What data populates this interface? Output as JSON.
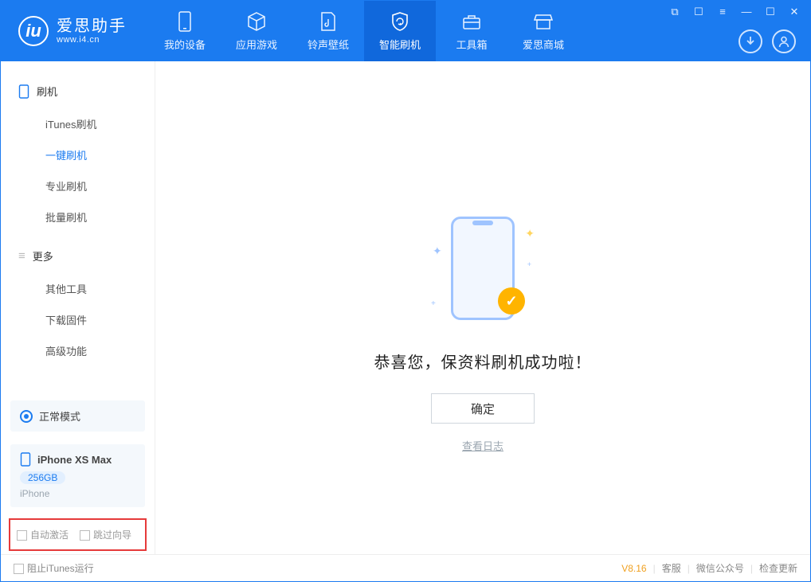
{
  "app": {
    "name_cn": "爱思助手",
    "url": "www.i4.cn"
  },
  "nav": {
    "my_device": "我的设备",
    "apps_games": "应用游戏",
    "ringtones": "铃声壁纸",
    "smart_flash": "智能刷机",
    "toolbox": "工具箱",
    "store": "爱思商城"
  },
  "sidebar": {
    "flash_section": "刷机",
    "items": {
      "itunes": "iTunes刷机",
      "onekey": "一键刷机",
      "pro": "专业刷机",
      "batch": "批量刷机"
    },
    "more_section": "更多",
    "more_items": {
      "other_tools": "其他工具",
      "download_fw": "下载固件",
      "advanced": "高级功能"
    },
    "mode_card": "正常模式",
    "device": {
      "name": "iPhone XS Max",
      "capacity": "256GB",
      "type": "iPhone"
    },
    "checkbox_autoactivate": "自动激活",
    "checkbox_skipwizard": "跳过向导"
  },
  "main": {
    "success_message": "恭喜您，保资料刷机成功啦！",
    "ok_button": "确定",
    "view_log": "查看日志"
  },
  "statusbar": {
    "block_itunes": "阻止iTunes运行",
    "version": "V8.16",
    "support": "客服",
    "wechat": "微信公众号",
    "check_update": "检查更新"
  }
}
